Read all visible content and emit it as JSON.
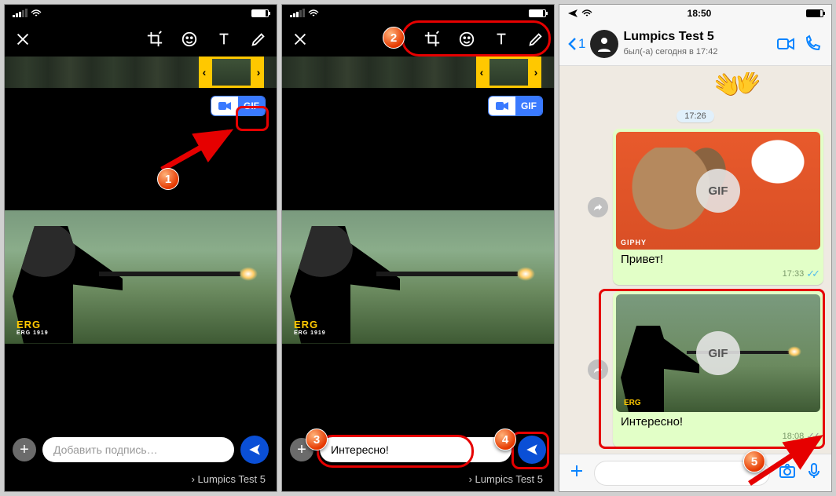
{
  "editor": {
    "status_time": "",
    "gif_label": "GIF",
    "caption_placeholder": "Добавить подпись…",
    "caption_value": "Интересно!",
    "recipient_prefix": "›",
    "recipient": "Lumpics Test 5",
    "jersey": "ERG",
    "jersey_sub": "ERG 1919"
  },
  "chat": {
    "status_time": "18:50",
    "back_count": "1",
    "title": "Lumpics Test 5",
    "subtitle": "был(-а) сегодня в 17:42",
    "chip_time": "17:26",
    "gif_badge": "GIF",
    "giphy": "GIPHY",
    "msg1_text": "Привет!",
    "msg1_time": "17:33",
    "msg2_text": "Интересно!",
    "msg2_time": "18:08",
    "msg2_jersey": "ERG"
  },
  "callouts": {
    "c1": "1",
    "c2": "2",
    "c3": "3",
    "c4": "4",
    "c5": "5"
  }
}
